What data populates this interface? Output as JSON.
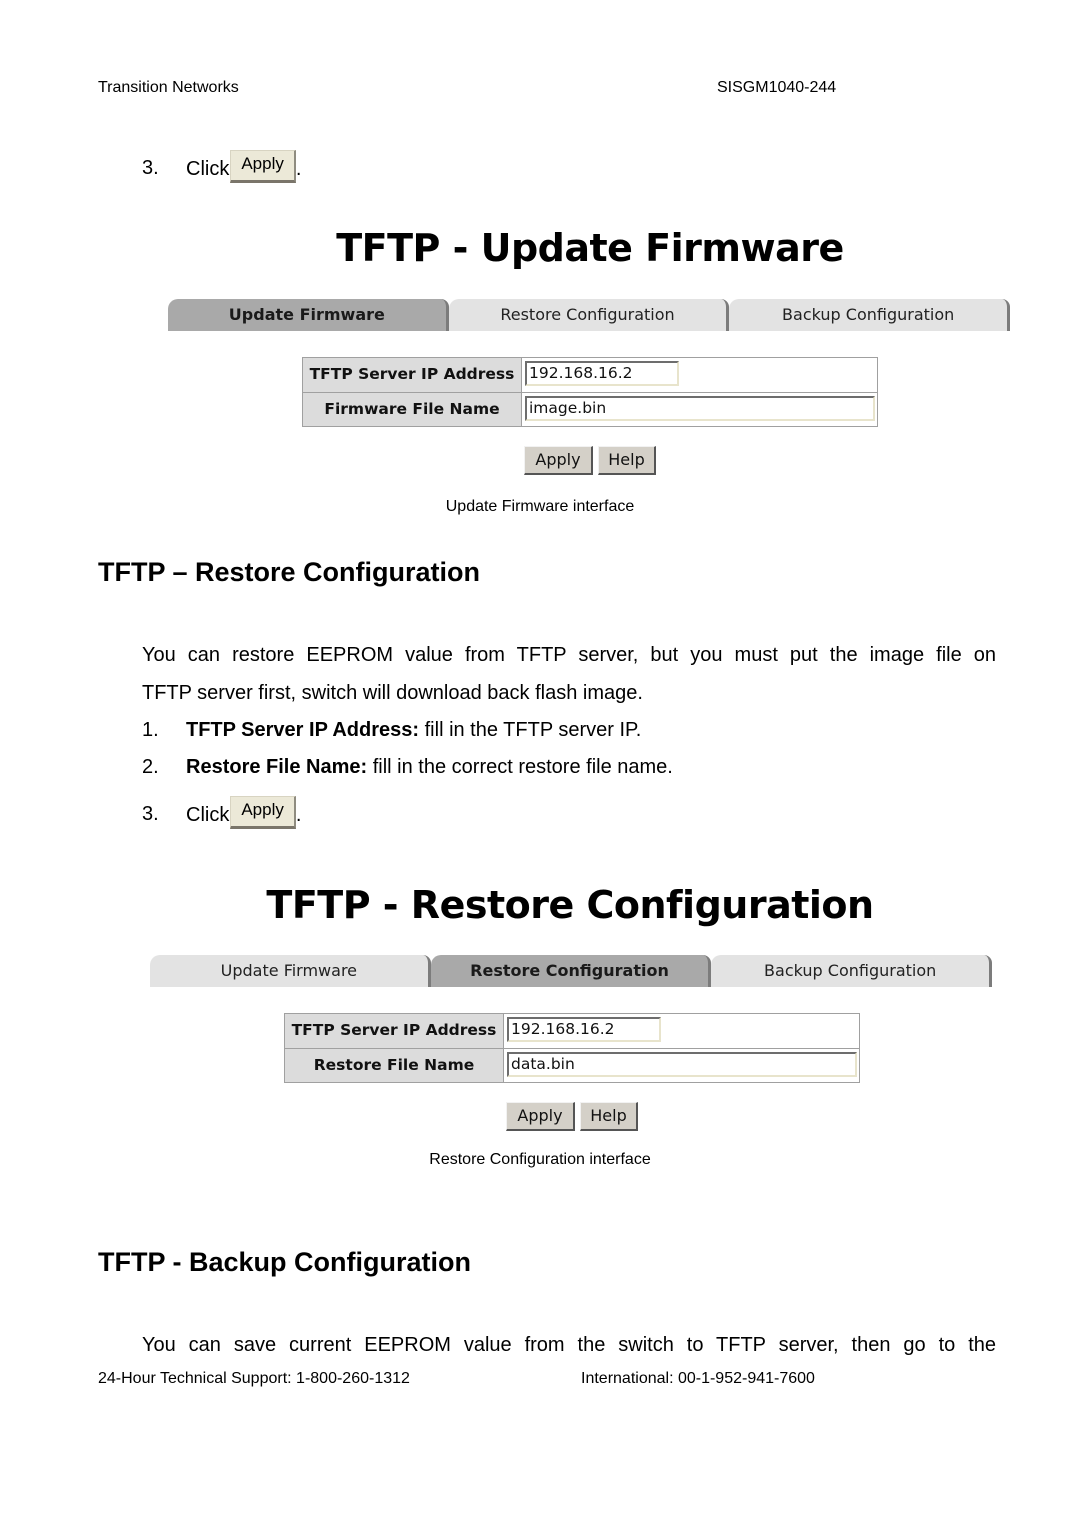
{
  "page_header": {
    "left": "Transition Networks",
    "right": "SISGM1040-244"
  },
  "update_section": {
    "step3": {
      "number": "3.",
      "click_label": "Click",
      "button_label": "Apply",
      "suffix": "."
    },
    "screenshot": {
      "title": "TFTP - Update Firmware",
      "tabs": [
        {
          "label": "Update Firmware",
          "active": true
        },
        {
          "label": "Restore Configuration",
          "active": false
        },
        {
          "label": "Backup Configuration",
          "active": false
        }
      ],
      "form": {
        "rows": [
          {
            "label": "TFTP Server IP Address",
            "value": "192.168.16.2"
          },
          {
            "label": "Firmware File Name",
            "value": "image.bin"
          }
        ]
      },
      "buttons": {
        "apply": "Apply",
        "help": "Help"
      }
    },
    "caption": "Update Firmware interface"
  },
  "restore_section": {
    "heading": "TFTP – Restore Configuration",
    "intro_line1": "You can restore EEPROM value from TFTP server, but you must put the image file on",
    "intro_line2": "TFTP server first, switch will download back flash image.",
    "steps": [
      {
        "number": "1.",
        "bold": "TFTP Server IP Address:",
        "text": " fill in the TFTP server IP."
      },
      {
        "number": "2.",
        "bold": "Restore File Name:",
        "text": " fill in the correct restore file name."
      }
    ],
    "step3": {
      "number": "3.",
      "click_label": "Click",
      "button_label": "Apply",
      "suffix": "."
    },
    "screenshot": {
      "title": "TFTP - Restore Configuration",
      "tabs": [
        {
          "label": "Update Firmware",
          "active": false
        },
        {
          "label": "Restore Configuration",
          "active": true
        },
        {
          "label": "Backup Configuration",
          "active": false
        }
      ],
      "form": {
        "rows": [
          {
            "label": "TFTP Server IP Address",
            "value": "192.168.16.2"
          },
          {
            "label": "Restore File Name",
            "value": "data.bin"
          }
        ]
      },
      "buttons": {
        "apply": "Apply",
        "help": "Help"
      }
    },
    "caption": "Restore Configuration interface"
  },
  "backup_section": {
    "heading": "TFTP - Backup Configuration",
    "intro_line1": "You can save current EEPROM value from the switch to TFTP server, then go to the"
  },
  "page_footer": {
    "support": "24-Hour Technical Support: 1-800-260-1312",
    "international": "International: 00-1-952-941-7600"
  }
}
